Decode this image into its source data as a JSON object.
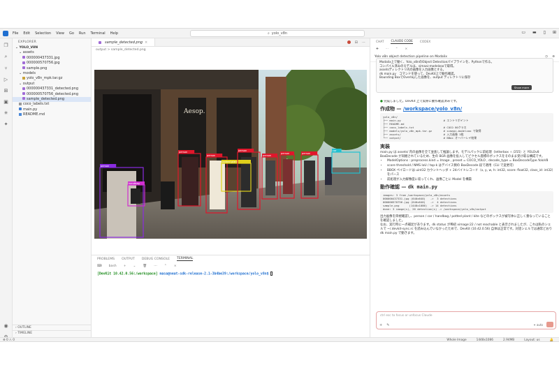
{
  "titlebar": {
    "menus": [
      "File",
      "Edit",
      "Selection",
      "View",
      "Go",
      "Run",
      "Terminal",
      "Help"
    ],
    "search": "yolo_v8n"
  },
  "explorer": {
    "header": "EXPLORER",
    "root": "YOLO_V8N",
    "items": [
      {
        "label": "assets",
        "depth": 1,
        "kind": "folder"
      },
      {
        "label": "000000437331.jpg",
        "depth": 2,
        "kind": "img"
      },
      {
        "label": "000000570756.jpg",
        "depth": 2,
        "kind": "img"
      },
      {
        "label": "sample.png",
        "depth": 2,
        "kind": "img"
      },
      {
        "label": "models",
        "depth": 1,
        "kind": "folder"
      },
      {
        "label": "yolo_v8n_mpk.tar.gz",
        "depth": 2,
        "kind": "tar"
      },
      {
        "label": "output",
        "depth": 1,
        "kind": "folder"
      },
      {
        "label": "000000437331_detected.png",
        "depth": 2,
        "kind": "img"
      },
      {
        "label": "000000570756_detected.png",
        "depth": 2,
        "kind": "img"
      },
      {
        "label": "sample_detected.png",
        "depth": 2,
        "kind": "img",
        "selected": true
      },
      {
        "label": "coco_labels.txt",
        "depth": 1,
        "kind": "txt"
      },
      {
        "label": "main.py",
        "depth": 1,
        "kind": "py"
      },
      {
        "label": "README.md",
        "depth": 1,
        "kind": "md"
      }
    ],
    "outline": "OUTLINE",
    "timeline": "TIMELINE"
  },
  "editor": {
    "tab": "sample_detected.png",
    "breadcrumb": "output > sample_detected.png"
  },
  "panel": {
    "tabs": [
      "PROBLEMS",
      "OUTPUT",
      "DEBUG CONSOLE",
      "TERMINAL"
    ],
    "active_tab": "TERMINAL",
    "shell": "bash",
    "prompt_host": "[DevKit 10.42.0.56:/workspace]",
    "prompt_user": "masa@neat-sdk-release-2.1-3b4be39:/workspace/yolo_v8n$"
  },
  "claude": {
    "tabs": [
      "CHAT",
      "CLAUDE CODE",
      "CODEX"
    ],
    "active_tab": "CLAUDE CODE",
    "title": "Yolo v8n object detection pipeline on Modalix",
    "user_msg": [
      "Modalix上で動く、Yolo_v8nのObject Detectionパイプラインを、Pythonで作る。",
      "コンパイル済みのモデルは、simaai-modelzooで取得。",
      "assetsディレクトリ内の画像を入力画像とする。",
      "dk main.py　コマンドを使って、DevKit上で動作確認。",
      "Bounding BoxでOverlayした画像を、output ディレクトリに保存"
    ],
    "show_more": "Show more",
    "done_line": "完成しました。DevKit 上で実際に動作確認済みです。",
    "h_artifact": "作成物 — ",
    "h_artifact_link": "/workspace/yolo_v8n/",
    "tree_code": "yolo_v8n/\n├── main.py                          # エントリポイント\n├── README.md\n├── coco_labels.txt                  # COCO 80クラス\n├── models/yolo_v8n_mpk.tar.gz       # simaai-modelzoo で取得\n├── assets/                          # 入力画像 3枚\n└── output/                          # BBox オーバーレイ結果",
    "h_impl": "実装",
    "impl_text": "main.py は assets/ 内の画像を全て並査して推論します。モデルパックに前処理（letterbox ÷ /255）と YOLOv8 BoxDecode が同梱されているため、生の BGR 画像を投入してピクセル座標のボックスをそのまま受け取る構成です。",
    "impl_link": "main.py",
    "bullets": [
      "ModelOptions : preprocess.kind = Image , preset = COCO_YOLO , decode_type = BoxDecodeType.YoloV8",
      "score threshold / NMS IoU / top-k はデバイス側の BoxDecode 段で適用（CLI で変更可）",
      "BBOX ペイロードは uint32 カウントヘッダ + 24バイトレコード（x, y, w, h: int32, score: float32, class_id: int32）をパース",
      "前処理が入力解像度に収ってくれ、画像ごとに Model を構築"
    ],
    "h_verify": "動作確認 — ",
    "h_verify_code": "dk main.py",
    "verify_code": "images: 3 from /workspace/yolo_v8n/assets\n000000437331.jpg (640x640)   ->  3 detections\n000000570756.jpg (640x640)   ->  4 detections\nsample.png      (1448x1086)  -> 14 detections\ndone: 3 image(s), 26 detection(s) -> /workspace/yolo_v8n/output",
    "verify_text1": "出力画像を目視確認し、person / car / handbag / potted plant / kite などのボックスが被写体に正しく重なっていることを確認しました。",
    "verify_text2": "なお、実行時に一点補足があります。dk status が稀初 ximage:22 / not reachable と表示されましたが、これは私のシェルで ~/.devkit-sync.rc を読み込んでいなかったためで、DevKit (10.42.0.56) 自体は正常です。対話シェルでは通常どおり dk main.py で動きます。",
    "input_placeholder": "ctrl esc to focus or unfocus Claude",
    "mode": "auto"
  },
  "status": {
    "left": "⊗ 0 ⚠ 0",
    "image": "Whole Image",
    "size": "1448x1086",
    "bytes": "2.94MB",
    "layout": "Layout: us"
  },
  "detections": [
    {
      "label": "handbag",
      "color": "#d02fd0"
    },
    {
      "label": "person",
      "color": "#8a2be2"
    },
    {
      "label": "person",
      "color": "#e0162b"
    },
    {
      "label": "potted plant",
      "color": "#e0d01a"
    },
    {
      "label": "car",
      "color": "#20c0d0"
    }
  ]
}
